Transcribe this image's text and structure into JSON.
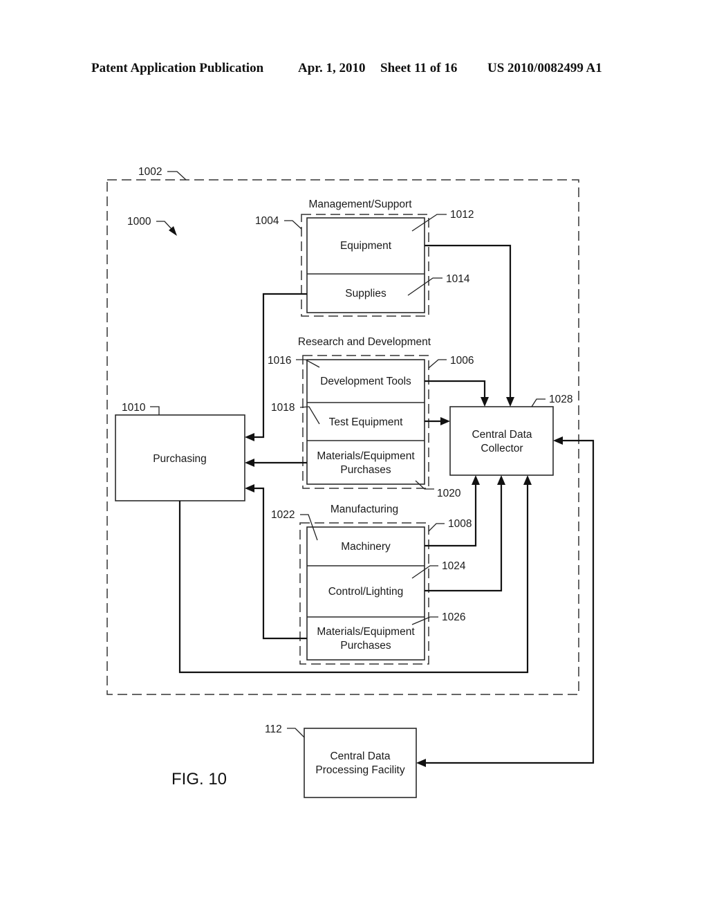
{
  "header": {
    "publication": "Patent Application Publication",
    "date": "Apr. 1, 2010",
    "sheet": "Sheet 11 of 16",
    "number": "US 2010/0082499 A1"
  },
  "figure": {
    "label": "FIG. 10",
    "system_ref": "1000",
    "enclosure_ref": "1002"
  },
  "groups": {
    "management": {
      "title": "Management/Support",
      "ref": "1004",
      "items": [
        {
          "label": "Equipment",
          "ref": "1012"
        },
        {
          "label": "Supplies",
          "ref": "1014"
        }
      ]
    },
    "research": {
      "title": "Research and Development",
      "ref": "1006",
      "items": [
        {
          "label": "Development Tools",
          "ref": "1016"
        },
        {
          "label": "Test Equipment",
          "ref": "1018"
        },
        {
          "label_line1": "Materials/Equipment",
          "label_line2": "Purchases",
          "ref": "1020"
        }
      ]
    },
    "manufacturing": {
      "title": "Manufacturing",
      "ref": "1008",
      "items": [
        {
          "label": "Machinery",
          "ref": "1022"
        },
        {
          "label": "Control/Lighting",
          "ref": "1024"
        },
        {
          "label_line1": "Materials/Equipment",
          "label_line2": "Purchases",
          "ref": "1026"
        }
      ]
    }
  },
  "purchasing": {
    "label": "Purchasing",
    "ref": "1010"
  },
  "collector": {
    "label_line1": "Central Data",
    "label_line2": "Collector",
    "ref": "1028"
  },
  "facility": {
    "label_line1": "Central Data",
    "label_line2": "Processing Facility",
    "ref": "112"
  },
  "connections": [
    {
      "from": "Equipment",
      "to": "Central Data Collector"
    },
    {
      "from": "Supplies",
      "to": "Purchasing"
    },
    {
      "from": "Development Tools",
      "to": "Central Data Collector"
    },
    {
      "from": "Test Equipment",
      "to": "Central Data Collector"
    },
    {
      "from": "R&D Materials/Equipment Purchases",
      "to": "Purchasing"
    },
    {
      "from": "Manufacturing Materials/Equipment Purchases",
      "to": "Purchasing"
    },
    {
      "from": "Machinery",
      "to": "Central Data Collector"
    },
    {
      "from": "Control/Lighting",
      "to": "Central Data Collector"
    },
    {
      "from": "Purchasing",
      "to": "Central Data Collector"
    },
    {
      "from": "Central Data Collector",
      "to": "Central Data Processing Facility",
      "bidirectional": true
    }
  ]
}
